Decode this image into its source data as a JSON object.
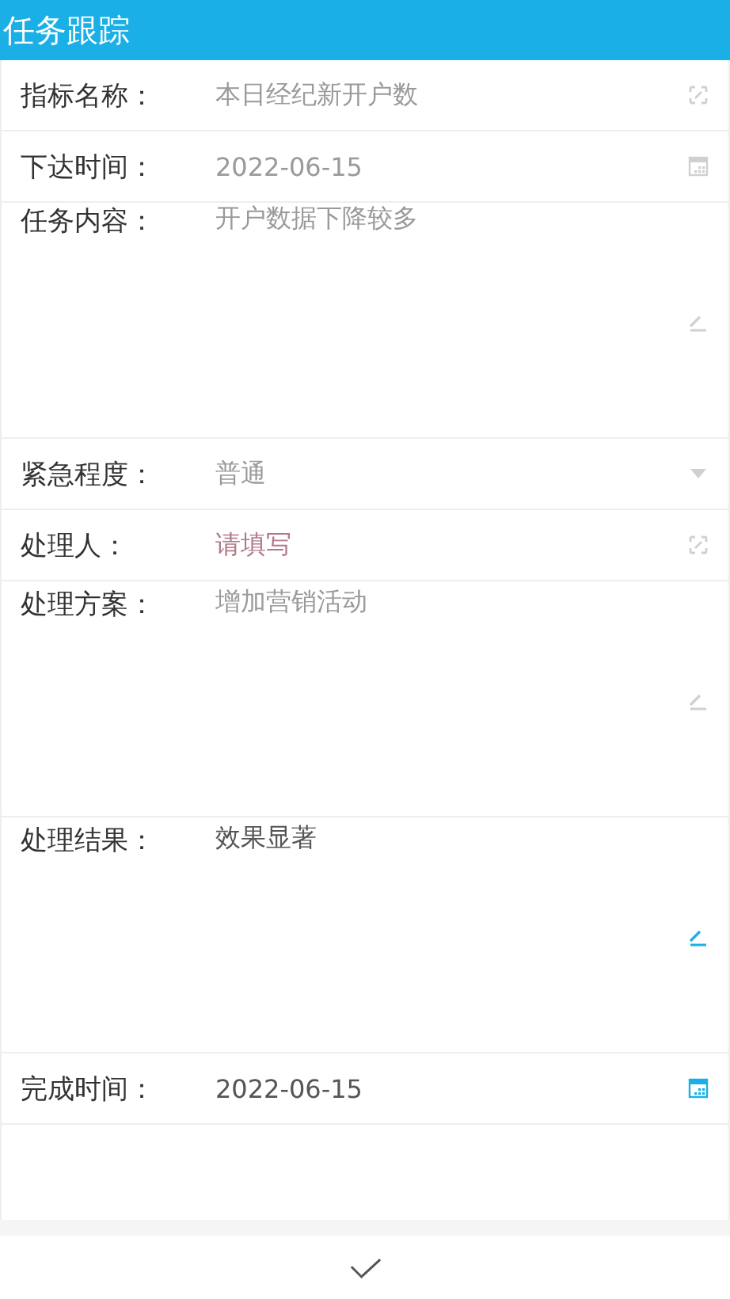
{
  "header": {
    "title": "任务跟踪"
  },
  "fields": [
    {
      "kind": "lookup",
      "label": "指标名称：",
      "value": "本日经纪新开户数",
      "disabled": true
    },
    {
      "kind": "date",
      "label": "下达时间：",
      "value": "2022-06-15",
      "disabled": true
    },
    {
      "kind": "textarea",
      "label": "任务内容：",
      "value": "开户数据下降较多",
      "disabled": true
    },
    {
      "kind": "select",
      "label": "紧急程度：",
      "value": "普通",
      "disabled": true
    },
    {
      "kind": "lookup",
      "label": "处理人：",
      "placeholder": "请填写",
      "disabled": true
    },
    {
      "kind": "textarea",
      "label": "处理方案：",
      "value": "增加营销活动",
      "disabled": true
    },
    {
      "kind": "textarea",
      "label": "处理结果：",
      "value": "效果显著",
      "disabled": false
    },
    {
      "kind": "date",
      "label": "完成时间：",
      "value": "2022-06-15",
      "disabled": false
    }
  ],
  "footer": {
    "kind": "confirm"
  }
}
